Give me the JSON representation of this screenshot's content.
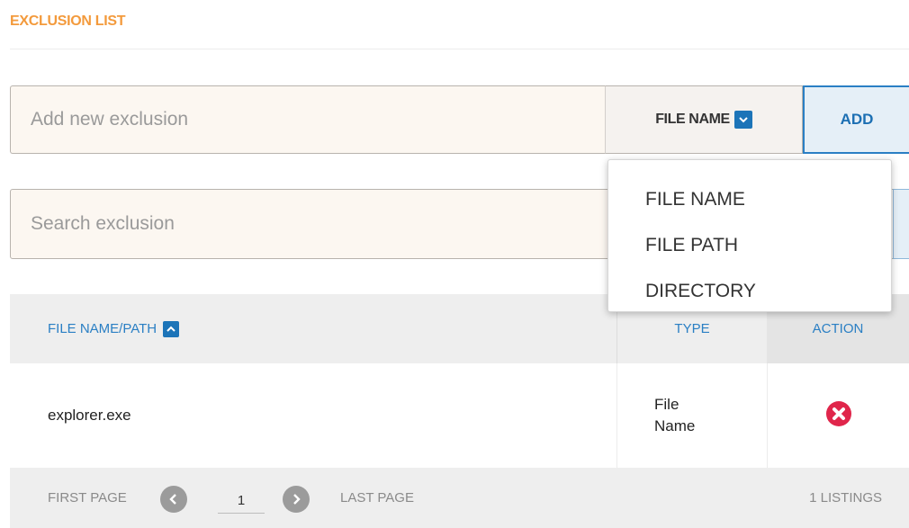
{
  "header": {
    "title": "EXCLUSION LIST"
  },
  "add_bar": {
    "placeholder": "Add new exclusion",
    "type_selected": "FILE NAME",
    "add_label": "ADD"
  },
  "search": {
    "placeholder": "Search exclusion"
  },
  "type_dropdown": {
    "options": [
      "FILE NAME",
      "FILE PATH",
      "DIRECTORY"
    ]
  },
  "table": {
    "columns": {
      "name": "FILE NAME/PATH",
      "type": "TYPE",
      "action": "ACTION"
    },
    "rows": [
      {
        "name": "explorer.exe",
        "type": "File Name"
      }
    ]
  },
  "pagination": {
    "first_label": "FIRST PAGE",
    "last_label": "LAST PAGE",
    "current_page": "1",
    "listings": "1 LISTINGS"
  },
  "icons": {
    "type_caret": "chevron-down-icon",
    "sort": "chevron-up-icon",
    "delete": "remove-circle-icon",
    "prev": "chevron-left-icon",
    "next": "chevron-right-icon"
  },
  "colors": {
    "title": "#f39a3c",
    "accent": "#1c74b8",
    "delete": "#e0264b",
    "field_bg": "#fcf7f1"
  }
}
